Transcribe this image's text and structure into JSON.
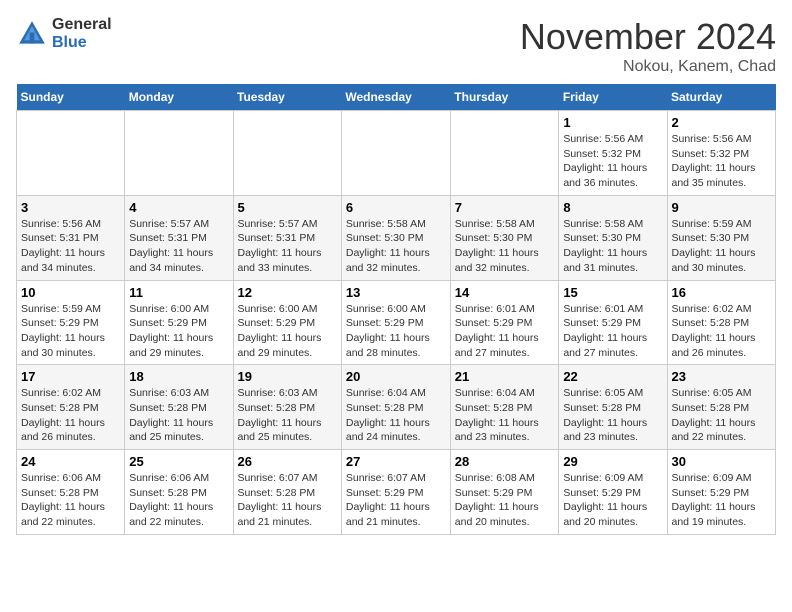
{
  "header": {
    "logo_general": "General",
    "logo_blue": "Blue",
    "month_title": "November 2024",
    "location": "Nokou, Kanem, Chad"
  },
  "days_of_week": [
    "Sunday",
    "Monday",
    "Tuesday",
    "Wednesday",
    "Thursday",
    "Friday",
    "Saturday"
  ],
  "weeks": [
    [
      {
        "day": "",
        "info": ""
      },
      {
        "day": "",
        "info": ""
      },
      {
        "day": "",
        "info": ""
      },
      {
        "day": "",
        "info": ""
      },
      {
        "day": "",
        "info": ""
      },
      {
        "day": "1",
        "info": "Sunrise: 5:56 AM\nSunset: 5:32 PM\nDaylight: 11 hours and 36 minutes."
      },
      {
        "day": "2",
        "info": "Sunrise: 5:56 AM\nSunset: 5:32 PM\nDaylight: 11 hours and 35 minutes."
      }
    ],
    [
      {
        "day": "3",
        "info": "Sunrise: 5:56 AM\nSunset: 5:31 PM\nDaylight: 11 hours and 34 minutes."
      },
      {
        "day": "4",
        "info": "Sunrise: 5:57 AM\nSunset: 5:31 PM\nDaylight: 11 hours and 34 minutes."
      },
      {
        "day": "5",
        "info": "Sunrise: 5:57 AM\nSunset: 5:31 PM\nDaylight: 11 hours and 33 minutes."
      },
      {
        "day": "6",
        "info": "Sunrise: 5:58 AM\nSunset: 5:30 PM\nDaylight: 11 hours and 32 minutes."
      },
      {
        "day": "7",
        "info": "Sunrise: 5:58 AM\nSunset: 5:30 PM\nDaylight: 11 hours and 32 minutes."
      },
      {
        "day": "8",
        "info": "Sunrise: 5:58 AM\nSunset: 5:30 PM\nDaylight: 11 hours and 31 minutes."
      },
      {
        "day": "9",
        "info": "Sunrise: 5:59 AM\nSunset: 5:30 PM\nDaylight: 11 hours and 30 minutes."
      }
    ],
    [
      {
        "day": "10",
        "info": "Sunrise: 5:59 AM\nSunset: 5:29 PM\nDaylight: 11 hours and 30 minutes."
      },
      {
        "day": "11",
        "info": "Sunrise: 6:00 AM\nSunset: 5:29 PM\nDaylight: 11 hours and 29 minutes."
      },
      {
        "day": "12",
        "info": "Sunrise: 6:00 AM\nSunset: 5:29 PM\nDaylight: 11 hours and 29 minutes."
      },
      {
        "day": "13",
        "info": "Sunrise: 6:00 AM\nSunset: 5:29 PM\nDaylight: 11 hours and 28 minutes."
      },
      {
        "day": "14",
        "info": "Sunrise: 6:01 AM\nSunset: 5:29 PM\nDaylight: 11 hours and 27 minutes."
      },
      {
        "day": "15",
        "info": "Sunrise: 6:01 AM\nSunset: 5:29 PM\nDaylight: 11 hours and 27 minutes."
      },
      {
        "day": "16",
        "info": "Sunrise: 6:02 AM\nSunset: 5:28 PM\nDaylight: 11 hours and 26 minutes."
      }
    ],
    [
      {
        "day": "17",
        "info": "Sunrise: 6:02 AM\nSunset: 5:28 PM\nDaylight: 11 hours and 26 minutes."
      },
      {
        "day": "18",
        "info": "Sunrise: 6:03 AM\nSunset: 5:28 PM\nDaylight: 11 hours and 25 minutes."
      },
      {
        "day": "19",
        "info": "Sunrise: 6:03 AM\nSunset: 5:28 PM\nDaylight: 11 hours and 25 minutes."
      },
      {
        "day": "20",
        "info": "Sunrise: 6:04 AM\nSunset: 5:28 PM\nDaylight: 11 hours and 24 minutes."
      },
      {
        "day": "21",
        "info": "Sunrise: 6:04 AM\nSunset: 5:28 PM\nDaylight: 11 hours and 23 minutes."
      },
      {
        "day": "22",
        "info": "Sunrise: 6:05 AM\nSunset: 5:28 PM\nDaylight: 11 hours and 23 minutes."
      },
      {
        "day": "23",
        "info": "Sunrise: 6:05 AM\nSunset: 5:28 PM\nDaylight: 11 hours and 22 minutes."
      }
    ],
    [
      {
        "day": "24",
        "info": "Sunrise: 6:06 AM\nSunset: 5:28 PM\nDaylight: 11 hours and 22 minutes."
      },
      {
        "day": "25",
        "info": "Sunrise: 6:06 AM\nSunset: 5:28 PM\nDaylight: 11 hours and 22 minutes."
      },
      {
        "day": "26",
        "info": "Sunrise: 6:07 AM\nSunset: 5:28 PM\nDaylight: 11 hours and 21 minutes."
      },
      {
        "day": "27",
        "info": "Sunrise: 6:07 AM\nSunset: 5:29 PM\nDaylight: 11 hours and 21 minutes."
      },
      {
        "day": "28",
        "info": "Sunrise: 6:08 AM\nSunset: 5:29 PM\nDaylight: 11 hours and 20 minutes."
      },
      {
        "day": "29",
        "info": "Sunrise: 6:09 AM\nSunset: 5:29 PM\nDaylight: 11 hours and 20 minutes."
      },
      {
        "day": "30",
        "info": "Sunrise: 6:09 AM\nSunset: 5:29 PM\nDaylight: 11 hours and 19 minutes."
      }
    ]
  ]
}
